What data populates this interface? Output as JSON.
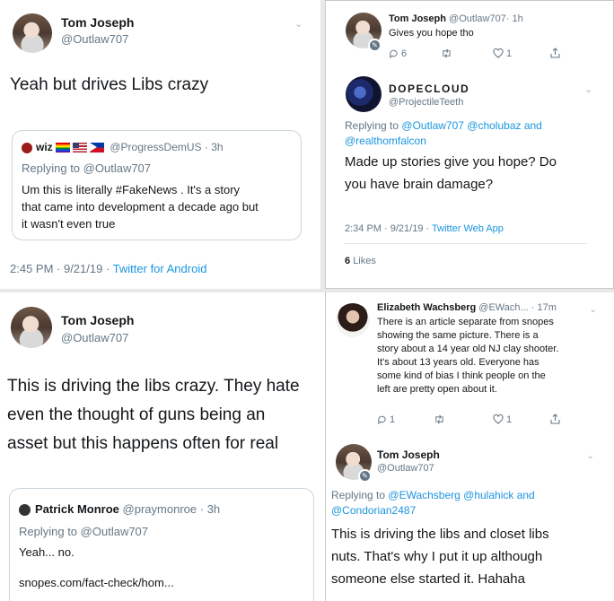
{
  "panel1": {
    "author": {
      "name": "Tom Joseph",
      "handle": "@Outlaw707"
    },
    "text": "Yeah but drives Libs crazy",
    "quote": {
      "name": "wiz",
      "handle": "@ProgressDemUS",
      "time": "· 3h",
      "replying_prefix": "Replying to",
      "replying_to": "@Outlaw707",
      "lines": [
        "Um this is literally #FakeNews . It's a story",
        "that came into development a decade ago but",
        "it wasn't even true"
      ]
    },
    "timestamp": "2:45 PM · 9/21/19 ·",
    "client": "Twitter for Android"
  },
  "panel2": {
    "top_tweet": {
      "name": "Tom Joseph",
      "handle": "@Outlaw707",
      "time": "· 1h",
      "text": "Gives you hope tho",
      "replies": "6",
      "likes": "1"
    },
    "reply": {
      "name": "DOPECLOUD",
      "handle": "@ProjectileTeeth",
      "replying_prefix": "Replying to",
      "replying_to_line1": "@Outlaw707 @cholubaz and",
      "replying_to_line2": "@realthomfalcon",
      "lines": [
        "Made up stories give you hope? Do",
        "you have brain damage?"
      ],
      "timestamp": "2:34 PM · 9/21/19 ·",
      "client": "Twitter Web App",
      "likes_count": "6",
      "likes_label": "Likes"
    }
  },
  "panel3": {
    "author": {
      "name": "Tom Joseph",
      "handle": "@Outlaw707"
    },
    "lines": [
      "This is driving the libs crazy. They hate",
      "even the thought of guns being an",
      "asset but this happens often for real"
    ],
    "quote": {
      "name": "Patrick Monroe",
      "handle": "@praymonroe",
      "time": "· 3h",
      "replying_prefix": "Replying to",
      "replying_to": "@Outlaw707",
      "text": "Yeah... no.",
      "link": "snopes.com/fact-check/hom..."
    }
  },
  "panel4": {
    "top_tweet": {
      "name": "Elizabeth Wachsberg",
      "handle": "@EWach...",
      "time": "· 17m",
      "lines": [
        "There is an article separate from snopes",
        "showing the same picture.  There is a",
        "story about a 14 year old NJ clay shooter.",
        "It's about 13 years old. Everyone has",
        "some kind of bias I think people on the",
        "left are pretty open about it."
      ],
      "replies": "1",
      "likes": "1"
    },
    "reply": {
      "name": "Tom Joseph",
      "handle": "@Outlaw707",
      "replying_prefix": "Replying to",
      "replying_to_line1": "@EWachsberg @hulahick and",
      "replying_to_line2": "@Condorian2487",
      "lines": [
        "This is driving the libs and closet libs",
        "nuts. That's why I put it up although",
        "someone else started it. Hahaha"
      ]
    }
  },
  "colors": {
    "link": "#1b95e0",
    "muted": "#657786",
    "text": "#14171a",
    "border": "#ccd6dd"
  }
}
